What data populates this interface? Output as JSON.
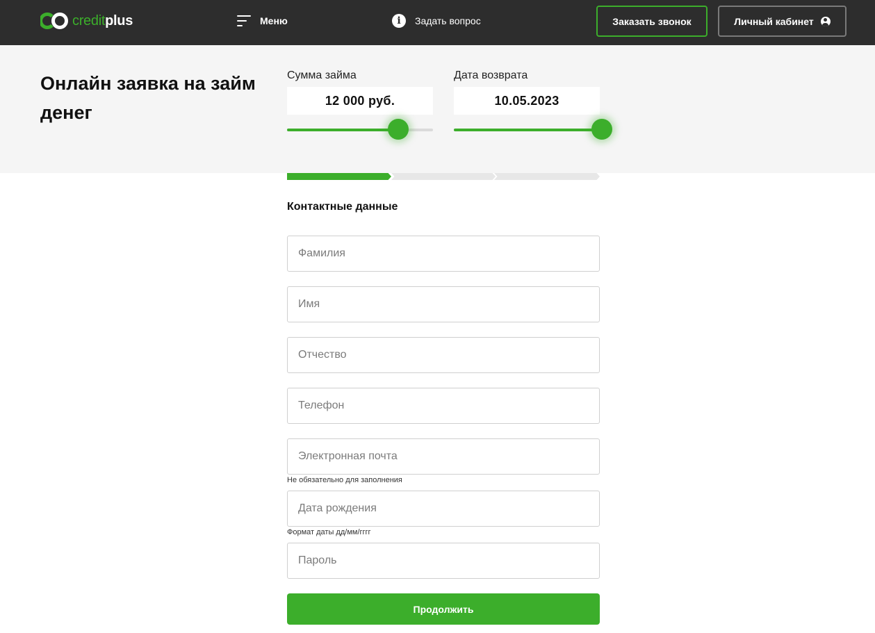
{
  "header": {
    "logo": {
      "part1": "credit",
      "part2": "plus"
    },
    "menu_label": "Меню",
    "ask_label": "Задать вопрос",
    "call_button": "Заказать звонок",
    "account_button": "Личный кабинет",
    "icons": {
      "menu": "hamburger-icon",
      "ask": "info-icon",
      "account": "user-icon"
    }
  },
  "calculator": {
    "title": "Онлайн заявка на займ денег",
    "amount": {
      "label": "Сумма займа",
      "value": "12 000 руб.",
      "slider_fraction": 0.76
    },
    "return_date": {
      "label": "Дата возврата",
      "value": "10.05.2023",
      "slider_fraction": 1.0
    }
  },
  "progress": {
    "total_steps": 3,
    "current_step": 1
  },
  "form": {
    "section_title": "Контактные данные",
    "fields": {
      "last_name": "Фамилия",
      "first_name": "Имя",
      "middle_name": "Отчество",
      "phone": "Телефон",
      "email": "Электронная почта",
      "birth_date": "Дата рождения",
      "password": "Пароль"
    },
    "hints": {
      "email": "Не обязательно для заполнения",
      "birth_date": "Формат даты дд/мм/гггг"
    },
    "submit_label": "Продолжить"
  },
  "colors": {
    "accent": "#3cae2b",
    "header_bg": "#2d2d2d",
    "band_bg": "#f5f5f5"
  }
}
